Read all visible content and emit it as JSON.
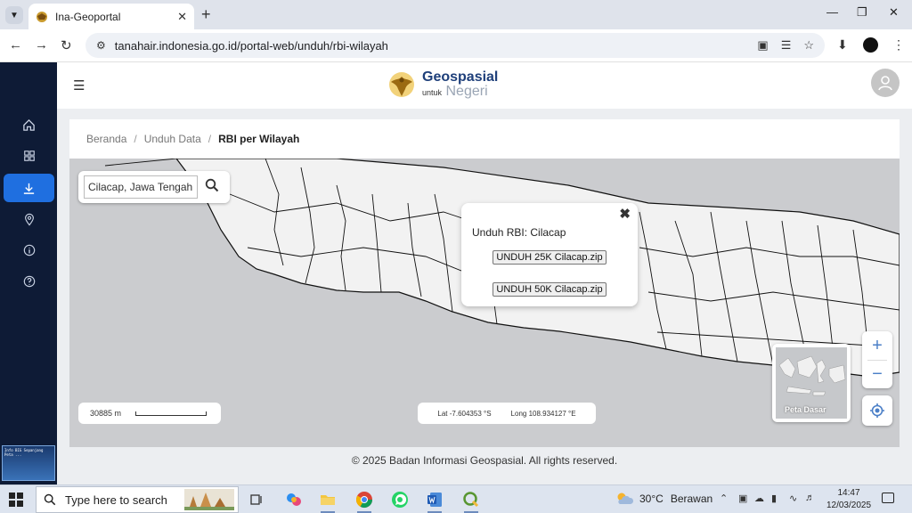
{
  "browser": {
    "tab_title": "Ina-Geoportal",
    "url": "tanahair.indonesia.go.id/portal-web/unduh/rbi-wilayah"
  },
  "sidebar": {
    "items": [
      {
        "name": "home-icon"
      },
      {
        "name": "grid-icon"
      },
      {
        "name": "download-icon",
        "active": true
      },
      {
        "name": "location-pin-icon"
      },
      {
        "name": "info-icon"
      },
      {
        "name": "help-icon"
      }
    ],
    "thumb_text": "Info BIG Sepanjang Peta ..."
  },
  "header": {
    "logo_main": "Geospasial",
    "logo_sub": "untuk",
    "logo_sub2": "Negeri"
  },
  "breadcrumb": {
    "home": "Beranda",
    "parent": "Unduh Data",
    "current": "RBI per Wilayah"
  },
  "map": {
    "search_value": "Cilacap, Jawa Tengah, Jawa",
    "popup": {
      "title": "Unduh RBI: Cilacap",
      "btn_25k": "UNDUH 25K Cilacap.zip",
      "btn_50k": "UNDUH 50K Cilacap.zip"
    },
    "scale_text": "30885 m",
    "lat": "Lat -7.604353 °S",
    "lon": "Long 108.934127 °E",
    "basemap_label": "Peta Dasar",
    "zoom_in": "+",
    "zoom_out": "−"
  },
  "footer": {
    "text": "© 2025 Badan Informasi Geospasial. All rights reserved."
  },
  "taskbar": {
    "search_placeholder": "Type here to search",
    "temp": "30°C",
    "weather": "Berawan",
    "time": "14:47",
    "date": "12/03/2025"
  }
}
